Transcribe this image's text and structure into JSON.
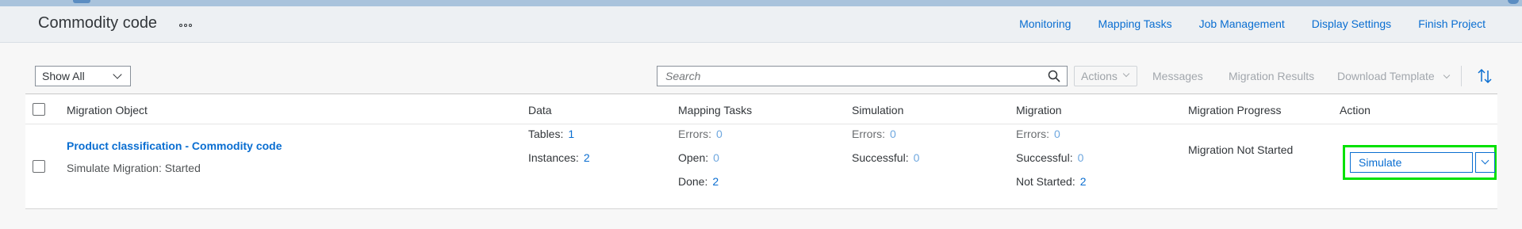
{
  "header": {
    "title": "Commodity code",
    "nav": [
      "Monitoring",
      "Mapping Tasks",
      "Job Management",
      "Display Settings",
      "Finish Project"
    ]
  },
  "toolbar": {
    "filter_value": "Show All",
    "search_placeholder": "Search",
    "actions_label": "Actions",
    "messages_label": "Messages",
    "migration_results_label": "Migration Results",
    "download_template_label": "Download Template"
  },
  "table": {
    "columns": [
      "Migration Object",
      "Data",
      "Mapping Tasks",
      "Simulation",
      "Migration",
      "Migration Progress",
      "Action"
    ],
    "rows": [
      {
        "object_name": "Product classification - Commodity code",
        "object_status": "Simulate Migration: Started",
        "data": {
          "tables_label": "Tables:",
          "tables": "1",
          "instances_label": "Instances:",
          "instances": "2"
        },
        "mapping_tasks": {
          "errors_label": "Errors:",
          "errors": "0",
          "open_label": "Open:",
          "open": "0",
          "done_label": "Done:",
          "done": "2"
        },
        "simulation": {
          "errors_label": "Errors:",
          "errors": "0",
          "successful_label": "Successful:",
          "successful": "0"
        },
        "migration": {
          "errors_label": "Errors:",
          "errors": "0",
          "successful_label": "Successful:",
          "successful": "0",
          "not_started_label": "Not Started:",
          "not_started": "2"
        },
        "progress": "Migration Not Started",
        "action_label": "Simulate"
      }
    ]
  },
  "colors": {
    "link": "#0a6ed1",
    "highlight": "#00e100",
    "header_bg": "#edf0f3",
    "page_bg": "#f7f7f7"
  },
  "icons": [
    "overflow-icon",
    "chevron-down-icon",
    "search-icon",
    "sort-icon"
  ]
}
